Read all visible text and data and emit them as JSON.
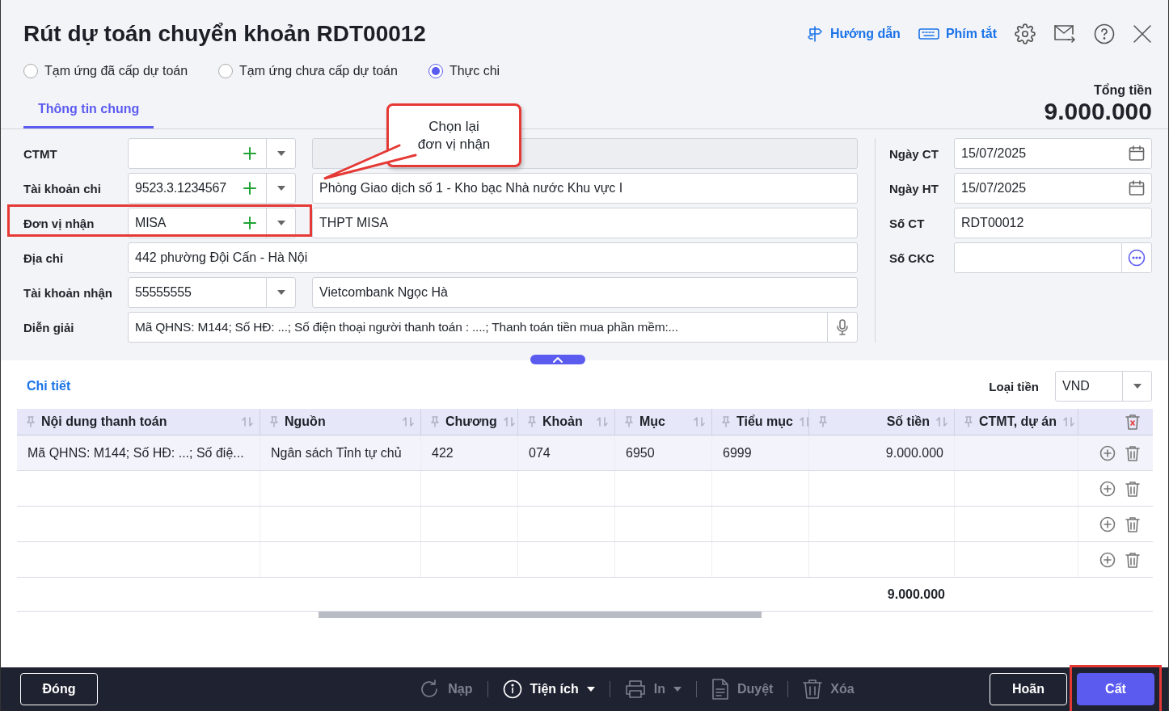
{
  "window": {
    "title": "Rút dự toán chuyển khoản RDT00012"
  },
  "header_links": [
    {
      "kind": "guide",
      "label": "Hướng dẫn"
    },
    {
      "kind": "keyboard",
      "label": "Phím tắt"
    }
  ],
  "header_icons": [
    {
      "kind": "settings"
    },
    {
      "kind": "mail"
    },
    {
      "kind": "help"
    },
    {
      "kind": "close"
    }
  ],
  "payment_types": [
    {
      "label": "Tạm ứng đã cấp dự toán",
      "selected": false
    },
    {
      "label": "Tạm ứng chưa cấp dự toán",
      "selected": false
    },
    {
      "label": "Thực chi",
      "selected": true
    }
  ],
  "tabs": [
    {
      "label": "Thông tin chung",
      "selected": true
    }
  ],
  "total": {
    "label": "Tổng tiền",
    "value": "9.000.000"
  },
  "left_fields": [
    {
      "label": "CTMT",
      "kind": "combo",
      "has_add": true,
      "detail_disabled": true,
      "highlighted": false
    },
    {
      "label": "Tài khoản chi",
      "kind": "combo",
      "value": "9523.3.1234567",
      "has_add": true,
      "detail": "Phòng Giao dịch số 1 - Kho bạc Nhà nước Khu vực I",
      "highlighted": false
    },
    {
      "label": "Đơn vị nhận",
      "kind": "combo",
      "value": "MISA",
      "has_add": true,
      "detail": "THPT MISA",
      "highlighted": true
    },
    {
      "label": "Địa chỉ",
      "kind": "text",
      "value": "442 phường Đội Cấn - Hà Nội",
      "highlighted": false
    },
    {
      "label": "Tài khoản nhận",
      "kind": "combo",
      "value": "55555555",
      "has_add": false,
      "detail": "Vietcombank Ngọc Hà",
      "highlighted": false
    },
    {
      "label": "Diễn giải",
      "kind": "memo",
      "value": "Mã QHNS: M144; Số HĐ: ...; Số điện thoại người thanh toán : ....; Thanh toán tiền mua phần mềm:...",
      "highlighted": false
    }
  ],
  "right_fields": [
    {
      "label": "Ngày CT",
      "kind": "date",
      "value": "15/07/2025"
    },
    {
      "label": "Ngày HT",
      "kind": "date",
      "value": "15/07/2025"
    },
    {
      "label": "Số CT",
      "kind": "text",
      "value": "RDT00012"
    },
    {
      "label": "Số CKC",
      "kind": "lookup"
    }
  ],
  "callout": {
    "lines": [
      "Chọn lại",
      "đơn vị nhận"
    ]
  },
  "detail": {
    "title": "Chi tiết",
    "currency_label": "Loại tiền",
    "currency": "VND",
    "columns": [
      {
        "label": "Nội dung thanh toán",
        "kind": "text"
      },
      {
        "label": "Nguồn",
        "kind": "text"
      },
      {
        "label": "Chương",
        "kind": "text"
      },
      {
        "label": "Khoản",
        "kind": "text"
      },
      {
        "label": "Mục",
        "kind": "text"
      },
      {
        "label": "Tiểu mục",
        "kind": "text"
      },
      {
        "label": "Số tiền",
        "kind": "amount"
      },
      {
        "label": "CTMT, dự án",
        "kind": "text"
      }
    ],
    "rows": [
      {
        "blank": false,
        "cells": [
          "Mã QHNS: M144; Số HĐ: ...; Số điệ...",
          "Ngân sách Tỉnh tự chủ",
          "422",
          "074",
          "6950",
          "6999",
          "9.000.000"
        ]
      },
      {
        "blank": true
      },
      {
        "blank": true
      },
      {
        "blank": true
      }
    ],
    "total": "9.000.000"
  },
  "footer": {
    "left": [
      {
        "label": "Đóng"
      }
    ],
    "tools": [
      {
        "kind": "reload",
        "label": "Nạp",
        "disabled": true,
        "caret": false
      },
      {
        "kind": "utility",
        "label": "Tiện ích",
        "disabled": false,
        "caret": true
      },
      {
        "kind": "print",
        "label": "In",
        "disabled": true,
        "caret": true
      },
      {
        "kind": "approve",
        "label": "Duyệt",
        "disabled": true,
        "caret": false
      },
      {
        "kind": "delete",
        "label": "Xóa",
        "disabled": true,
        "caret": false
      }
    ],
    "right": [
      {
        "label": "Hoãn",
        "primary": false,
        "highlighted": false
      },
      {
        "label": "Cất",
        "primary": true,
        "highlighted": true
      }
    ]
  }
}
